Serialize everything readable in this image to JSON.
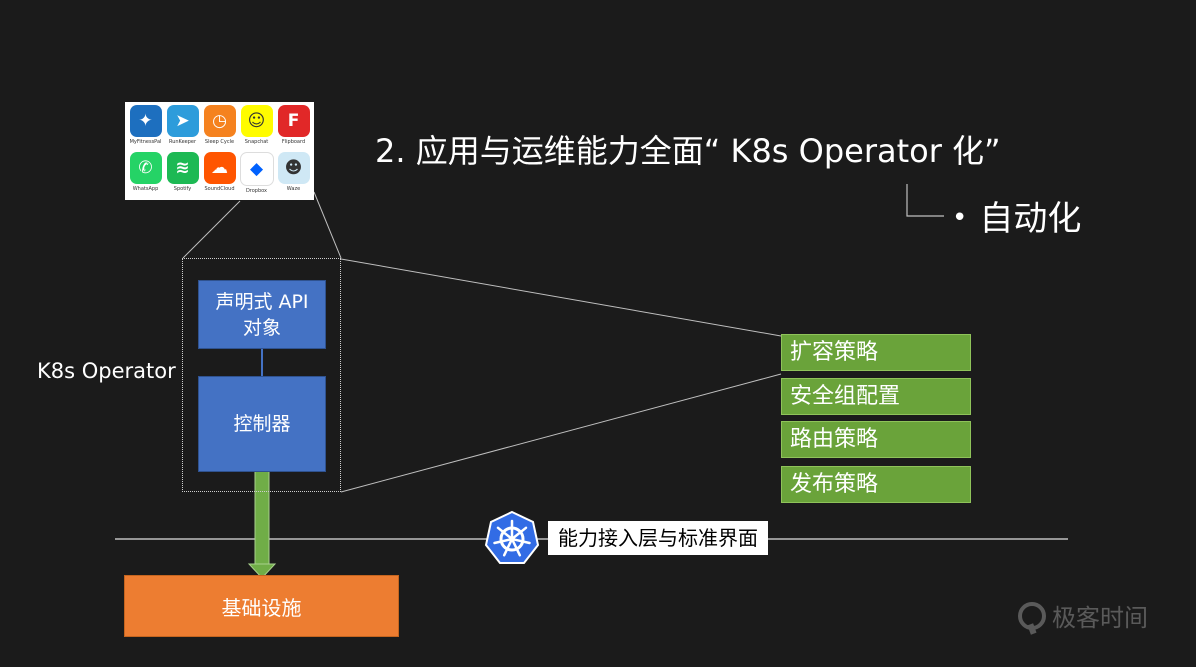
{
  "title": "2. 应用与运维能力全面“ K8s Operator 化”",
  "subtitle": {
    "bullet": "•",
    "text": "自动化"
  },
  "apps": [
    {
      "name": "MyFitnessPal",
      "glyph": "✦",
      "color": "#1d6fbf",
      "icon": "figure-icon"
    },
    {
      "name": "RunKeeper",
      "glyph": "➤",
      "color": "#2d9cdb",
      "icon": "runner-icon"
    },
    {
      "name": "Sleep Cycle",
      "glyph": "◷",
      "color": "#f5821f",
      "icon": "clock-icon"
    },
    {
      "name": "Snapchat",
      "glyph": "☺",
      "color": "#fffc00",
      "icon": "ghost-icon"
    },
    {
      "name": "Flipboard",
      "glyph": "F",
      "color": "#e12828",
      "icon": "flip-icon"
    },
    {
      "name": "WhatsApp",
      "glyph": "✆",
      "color": "#25d366",
      "icon": "phone-icon"
    },
    {
      "name": "Spotify",
      "glyph": "≋",
      "color": "#1db954",
      "icon": "waves-icon"
    },
    {
      "name": "SoundCloud",
      "glyph": "☁",
      "color": "#ff5500",
      "icon": "cloud-icon"
    },
    {
      "name": "Dropbox",
      "glyph": "◆",
      "color": "#ffffff",
      "icon": "box-icon"
    },
    {
      "name": "Waze",
      "glyph": "☻",
      "color": "#cfe8f5",
      "icon": "waze-icon"
    }
  ],
  "operator": {
    "label": "K8s Operator",
    "api_object": "声明式 API\n对象",
    "controller": "控制器"
  },
  "strategies": [
    "扩容策略",
    "安全组配置",
    "路由策略",
    "发布策略"
  ],
  "infrastructure": "基础设施",
  "interface_layer": "能力接入层与标准界面",
  "logo_text": "极客时间",
  "colors": {
    "background": "#1b1b1b",
    "blue": "#4472c4",
    "green": "#6aa33a",
    "orange": "#ed7d31",
    "k8s_blue": "#326ce5"
  }
}
